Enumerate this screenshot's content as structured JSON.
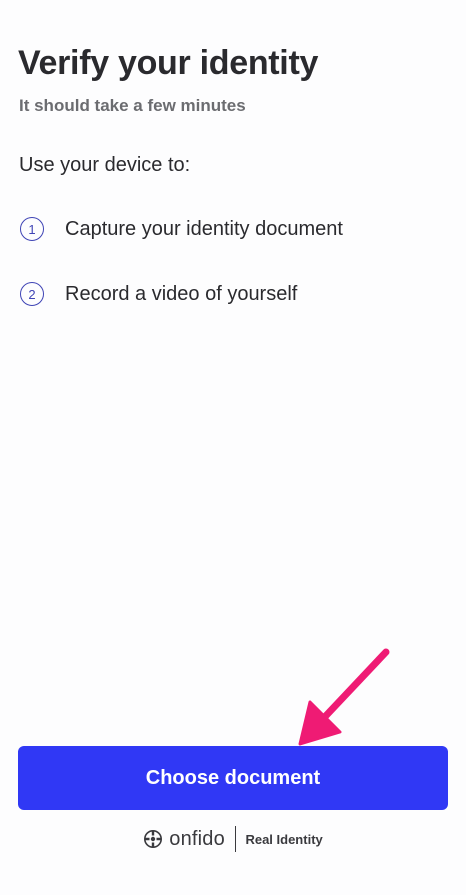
{
  "header": {
    "title": "Verify your identity",
    "subtitle": "It should take a few minutes"
  },
  "intro": "Use your device to:",
  "steps": [
    {
      "number": "1",
      "label": "Capture your identity document"
    },
    {
      "number": "2",
      "label": "Record a video of yourself"
    }
  ],
  "primary_button": {
    "label": "Choose document"
  },
  "footer": {
    "brand": "onfido",
    "tagline": "Real Identity"
  },
  "annotation": {
    "color": "#ef1b74",
    "icon": "arrow-icon"
  },
  "colors": {
    "accent": "#3038f5",
    "step_outline": "#3f44b5",
    "text": "#2a2a2e"
  }
}
